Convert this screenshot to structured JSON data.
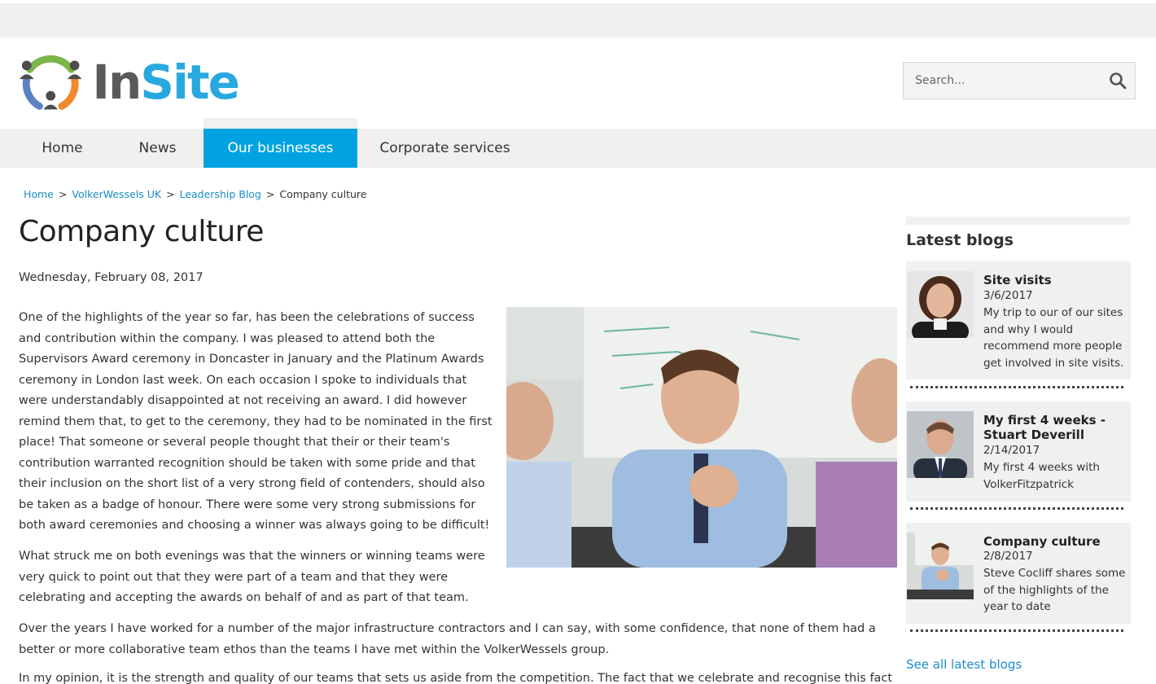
{
  "brand": {
    "name_part1": "In",
    "name_part2": "Site"
  },
  "search": {
    "placeholder": "Search..."
  },
  "nav": {
    "items": [
      {
        "label": "Home"
      },
      {
        "label": "News"
      },
      {
        "label": "Our businesses"
      },
      {
        "label": "Corporate services"
      }
    ],
    "active": "Our businesses"
  },
  "breadcrumb": {
    "items": [
      "Home",
      "VolkerWessels UK",
      "Leadership Blog"
    ],
    "current": "Company culture",
    "separator": ">"
  },
  "article": {
    "title": "Company culture",
    "date": "Wednesday, February 08, 2017",
    "paragraphs": [
      "One of the highlights of the year so far, has been the celebrations of success and contribution within the company.  I was pleased to attend both the Supervisors Award ceremony in Doncaster in January and the Platinum Awards ceremony in London last week.  On each occasion I spoke to individuals that were understandably disappointed at not receiving an award.  I did however remind them that, to get to the ceremony, they had to be nominated in the first place!  That someone or several people thought that their or their team's contribution warranted recognition should be taken with some pride and that their inclusion on the short list of a very strong field of contenders, should also be taken as a badge of honour. There were some very strong submissions for both award ceremonies and choosing a winner was always going to be difficult!",
      "What struck me on both evenings was that the winners or winning teams were very quick to point out that they were part of a team and that they were celebrating and accepting the awards on behalf of and as part of that team.",
      "Over the years I have worked for a number of the major infrastructure contractors and I can say, with some confidence, that none of them had a better or more collaborative team ethos than the teams I have met within the VolkerWessels group.",
      "In my opinion, it is the strength and quality of our teams that sets us aside from the competition.  The fact that we celebrate and recognise this fact is"
    ]
  },
  "sidebar": {
    "title": "Latest blogs",
    "blogs": [
      {
        "title": "Site visits",
        "date": "3/6/2017",
        "description": "My trip to our of our sites and why I would recommend more people get involved in site visits."
      },
      {
        "title": "My first 4 weeks - Stuart Deverill",
        "date": "2/14/2017",
        "description": "My first 4 weeks with VolkerFitzpatrick"
      },
      {
        "title": "Company culture",
        "date": "2/8/2017",
        "description": "Steve Cocliff shares some of the highlights of the year to date"
      }
    ],
    "see_all": "See all latest blogs"
  },
  "colors": {
    "accent": "#00a3e0",
    "link": "#1a8dc9",
    "nav_bg": "#f0f0f0"
  },
  "icons": {
    "search": "magnifier-icon",
    "logo": "people-circle-logo"
  }
}
